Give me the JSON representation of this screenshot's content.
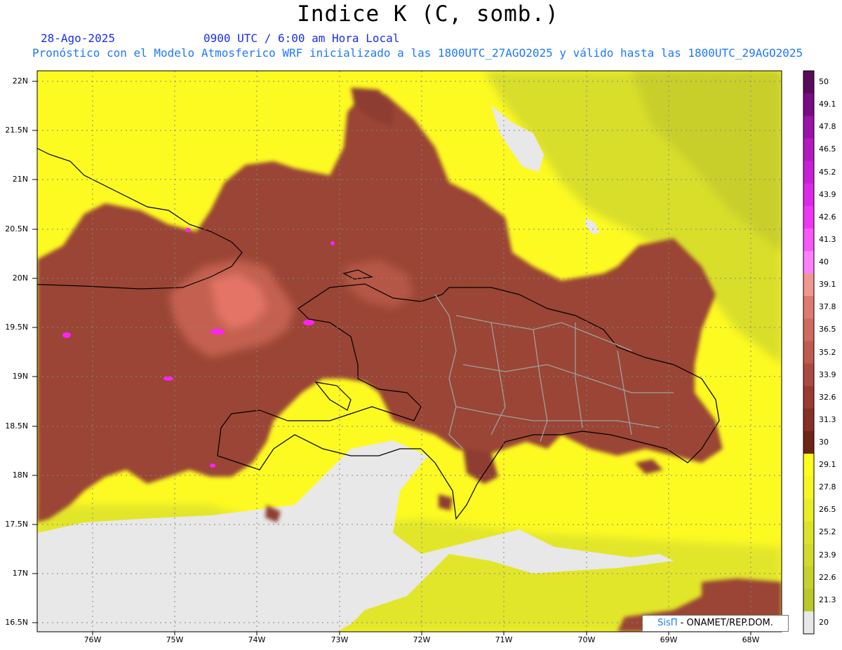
{
  "title": "Indice K (C, somb.)",
  "subtitle": {
    "date": "28-Ago-2025",
    "time": "0900 UTC / 6:00 am Hora Local",
    "description": "Pronóstico con el Modelo Atmosferico WRF inicializado a las 1800UTC_27AGO2025 y válido hasta las  1800UTC_29AGO2025"
  },
  "axes": {
    "lat_labels": [
      "22N",
      "21.5N",
      "21N",
      "20.5N",
      "20N",
      "19.5N",
      "19N",
      "18.5N",
      "18N",
      "17.5N",
      "17N",
      "16.5N"
    ],
    "lon_labels": [
      "76W",
      "75W",
      "74W",
      "73W",
      "72W",
      "71W",
      "70W",
      "69W",
      "68W"
    ]
  },
  "colorbar": {
    "labels": [
      "50",
      "49.1",
      "47.8",
      "46.5",
      "45.2",
      "43.9",
      "42.6",
      "41.3",
      "40",
      "39.1",
      "37.8",
      "36.5",
      "35.2",
      "33.9",
      "32.6",
      "31.3",
      "30",
      "29.1",
      "27.8",
      "26.5",
      "25.2",
      "23.9",
      "22.6",
      "21.3",
      "20"
    ],
    "colors": [
      "#5a0a5a",
      "#7a0a85",
      "#9a12a8",
      "#b21ac0",
      "#c820d6",
      "#dc28e8",
      "#ec38f4",
      "#f858f8",
      "#ff80ff",
      "#f09890",
      "#e07a70",
      "#d06a5e",
      "#c05a4e",
      "#ad4a40",
      "#9a3a32",
      "#863026",
      "#6e2418",
      "#fffc20",
      "#f6f622",
      "#eaee26",
      "#dde32a",
      "#d2db2c",
      "#c6d22c",
      "#bac82a",
      "#e8e8e8"
    ]
  },
  "credit": {
    "logo": "SisΠ",
    "text": " - ONAMET/REP.DOM."
  },
  "palette": {
    "sea_gray": "#e6e6e6",
    "low_yellow": "#ffff20",
    "mid_yellow": "#e8ec30",
    "olive": "#c8d028",
    "high_brown": "#9e4636",
    "core_brown": "#b85a4a",
    "hot_pink": "#e87060",
    "magenta": "#ff20ff",
    "coast": "#000000",
    "provinces": "#a0a0a0"
  }
}
